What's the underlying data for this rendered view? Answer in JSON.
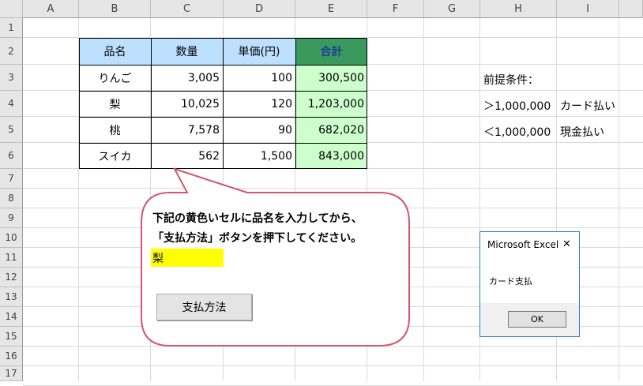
{
  "columns": [
    "A",
    "B",
    "C",
    "D",
    "E",
    "F",
    "G",
    "H",
    "I"
  ],
  "rows": [
    "1",
    "2",
    "3",
    "4",
    "5",
    "6",
    "7",
    "8",
    "9",
    "10",
    "11",
    "12",
    "13",
    "14",
    "15",
    "16",
    "17"
  ],
  "table": {
    "headers": [
      "品名",
      "数量",
      "単価(円)",
      "合計"
    ],
    "rows": [
      [
        "りんご",
        "3,005",
        "100",
        "300,500"
      ],
      [
        "梨",
        "10,025",
        "120",
        "1,203,000"
      ],
      [
        "桃",
        "7,578",
        "90",
        "682,020"
      ],
      [
        "スイカ",
        "562",
        "1,500",
        "843,000"
      ]
    ]
  },
  "conditions": {
    "title": "前提条件：",
    "items": [
      {
        "condition": "＞1,000,000",
        "result": "カード払い"
      },
      {
        "condition": "＜1,000,000",
        "result": "現金払い"
      }
    ]
  },
  "callout": {
    "line1": "下記の黄色いセルに品名を入力してから、",
    "line2": "「支払方法」ボタンを押下してください。",
    "input_value": "梨",
    "button_label": "支払方法"
  },
  "dialog": {
    "title": "Microsoft Excel",
    "message": "カード支払",
    "ok_label": "OK",
    "close_symbol": "✕"
  },
  "colors": {
    "header_fill": "#bde0ff",
    "total_header_fill": "#3a9a5e",
    "total_header_text": "#1f3b99",
    "total_cell_fill": "#ccffcc",
    "input_fill": "#ffff00",
    "callout_border": "#d6546c"
  }
}
